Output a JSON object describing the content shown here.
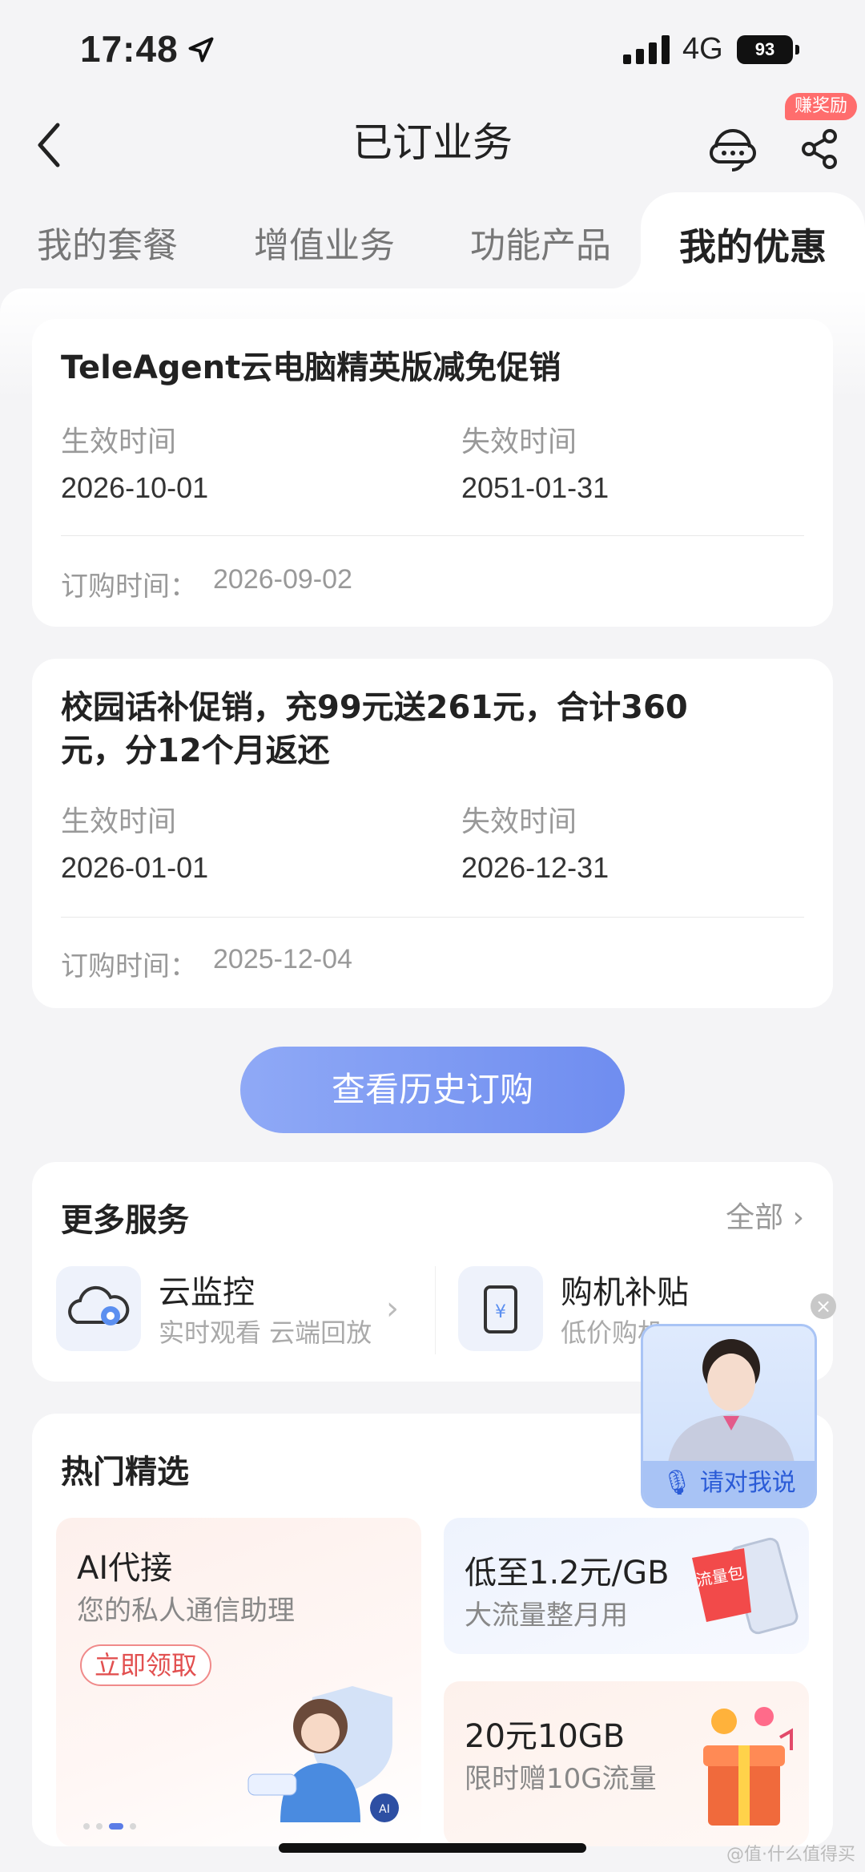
{
  "status_bar": {
    "time": "17:48",
    "network": "4G",
    "battery": "93"
  },
  "nav": {
    "title": "已订业务",
    "reward_badge": "赚奖励"
  },
  "tabs": [
    {
      "label": "我的套餐"
    },
    {
      "label": "增值业务"
    },
    {
      "label": "功能产品"
    },
    {
      "label": "我的优惠",
      "active": true
    }
  ],
  "promotions": [
    {
      "title": "TeleAgent云电脑精英版减免促销",
      "effective_label": "生效时间",
      "effective_date": "2026-10-01",
      "expire_label": "失效时间",
      "expire_date": "2051-01-31",
      "order_label": "订购时间：",
      "order_date": "2026-09-02"
    },
    {
      "title_line1": "校园话补促销，充99元送261元，合计360",
      "title_line2": "元，分12个月返还",
      "effective_label": "生效时间",
      "effective_date": "2026-01-01",
      "expire_label": "失效时间",
      "expire_date": "2026-12-31",
      "order_label": "订购时间：",
      "order_date": "2025-12-04"
    }
  ],
  "history_button": "查看历史订购",
  "more_services": {
    "title": "更多服务",
    "all_label": "全部",
    "items": [
      {
        "name": "云监控",
        "sub": "实时观看 云端回放",
        "icon": "cloud-camera-icon"
      },
      {
        "name": "购机补贴",
        "sub": "低价购机",
        "icon": "phone-yuan-icon"
      }
    ]
  },
  "hot_picks": {
    "title": "热门精选",
    "big": {
      "title": "AI代接",
      "sub": "您的私人通信助理",
      "cta": "立即领取",
      "icon": "ai-assistant-illustration"
    },
    "small": [
      {
        "title": "低至1.2元/GB",
        "sub": "大流量整月用",
        "sticker": "流量包"
      },
      {
        "title": "20元10GB",
        "sub": "限时赠10G流量",
        "icon": "gift-box-illustration"
      }
    ]
  },
  "assistant": {
    "label": "请对我说"
  },
  "watermark": "@值·什么值得买",
  "colors": {
    "accent": "#6f8df0",
    "badge": "#ff6d6d",
    "claim": "#e25050"
  }
}
